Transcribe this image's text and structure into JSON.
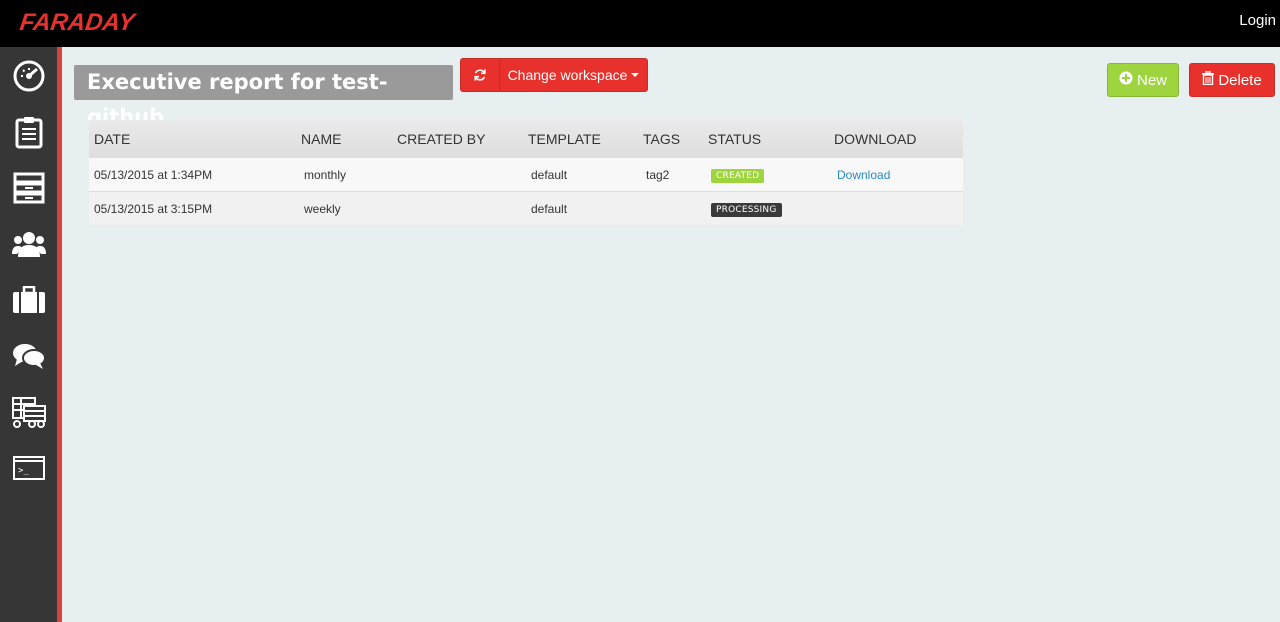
{
  "header": {
    "logo_text": "FARADAY",
    "login_label": "Login"
  },
  "sidebar": {
    "items": [
      {
        "name": "dashboard-icon"
      },
      {
        "name": "status-report-icon"
      },
      {
        "name": "hosts-icon"
      },
      {
        "name": "users-icon"
      },
      {
        "name": "workspaces-icon"
      },
      {
        "name": "comments-icon"
      },
      {
        "name": "reports-icon"
      },
      {
        "name": "terminal-icon"
      }
    ]
  },
  "page": {
    "title": "Executive report for test-github",
    "change_workspace_label": "Change workspace",
    "new_label": "New",
    "delete_label": "Delete"
  },
  "table": {
    "columns": [
      "DATE",
      "NAME",
      "CREATED BY",
      "TEMPLATE",
      "TAGS",
      "STATUS",
      "DOWNLOAD"
    ],
    "rows": [
      {
        "date": "05/13/2015 at 1:34PM",
        "name": "monthly",
        "created_by": "",
        "template": "default",
        "tags": "tag2",
        "status": "CREATED",
        "download": "Download"
      },
      {
        "date": "05/13/2015 at 3:15PM",
        "name": "weekly",
        "created_by": "",
        "template": "default",
        "tags": "",
        "status": "PROCESSING",
        "download": ""
      }
    ]
  },
  "colors": {
    "brand_red": "#e8312c",
    "success_green": "#9ed53e",
    "sidebar_dark": "#363636",
    "link_blue": "#2a8bc8"
  }
}
